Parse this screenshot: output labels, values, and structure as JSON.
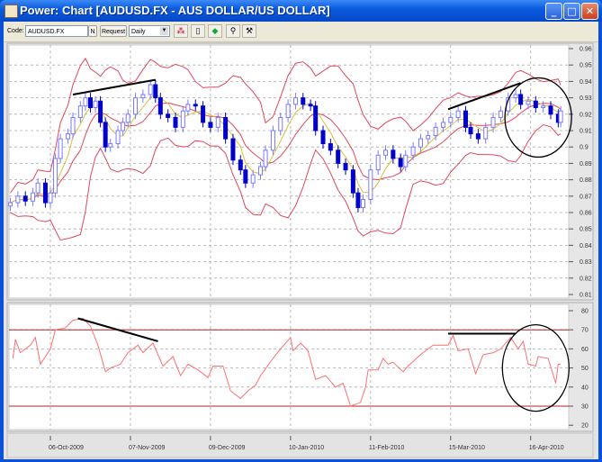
{
  "window": {
    "title": "Power: Chart [AUDUSD.FX - AUS DOLLAR/US DOLLAR]",
    "controls": {
      "minimize": "_",
      "maximize": "□",
      "close": "✕"
    }
  },
  "toolbar": {
    "code_label": "Code:",
    "code_value": "AUDUSD.FX",
    "n_button": "N",
    "request_button": "Request",
    "period_value": "Daily",
    "icons": [
      "chart-style-icon",
      "new-page-icon",
      "color-icon",
      "zoom-icon",
      "tools-icon"
    ]
  },
  "colors": {
    "candle_down": "#0000cc",
    "candle_up": "#7a7aff",
    "bollinger": "#e0485a",
    "moving_average": "#d4c33a",
    "rsi": "#ff7070",
    "rsi_levels": "#b02020",
    "annotation": "#000000"
  },
  "chart_data": [
    {
      "type": "candlestick",
      "panel": "price",
      "yticks": [
        "0.96",
        "0.95",
        "0.94",
        "0.93",
        "0.92",
        "0.91",
        "0.9",
        "0.89",
        "0.88",
        "0.87",
        "0.86",
        "0.85",
        "0.84",
        "0.83",
        "0.82",
        "0.81"
      ],
      "ylim": [
        0.81,
        0.96
      ],
      "grid": true,
      "overlays": [
        "Bollinger Bands",
        "Moving Average"
      ],
      "close": [
        [
          "2009-09-20",
          0.866
        ],
        [
          "2009-09-23",
          0.87
        ],
        [
          "2009-09-26",
          0.867
        ],
        [
          "2009-09-29",
          0.872
        ],
        [
          "2009-10-01",
          0.878
        ],
        [
          "2009-10-04",
          0.866
        ],
        [
          "2009-10-06",
          0.872
        ],
        [
          "2009-10-08",
          0.893
        ],
        [
          "2009-10-10",
          0.905
        ],
        [
          "2009-10-13",
          0.908
        ],
        [
          "2009-10-15",
          0.918
        ],
        [
          "2009-10-18",
          0.925
        ],
        [
          "2009-10-20",
          0.93
        ],
        [
          "2009-10-22",
          0.924
        ],
        [
          "2009-10-24",
          0.928
        ],
        [
          "2009-10-26",
          0.915
        ],
        [
          "2009-10-28",
          0.9
        ],
        [
          "2009-10-30",
          0.902
        ],
        [
          "2009-11-02",
          0.91
        ],
        [
          "2009-11-04",
          0.915
        ],
        [
          "2009-11-06",
          0.92
        ],
        [
          "2009-11-09",
          0.93
        ],
        [
          "2009-11-12",
          0.932
        ],
        [
          "2009-11-15",
          0.938
        ],
        [
          "2009-11-17",
          0.93
        ],
        [
          "2009-11-19",
          0.92
        ],
        [
          "2009-11-22",
          0.918
        ],
        [
          "2009-11-25",
          0.912
        ],
        [
          "2009-11-28",
          0.922
        ],
        [
          "2009-11-30",
          0.926
        ],
        [
          "2009-12-03",
          0.925
        ],
        [
          "2009-12-06",
          0.915
        ],
        [
          "2009-12-09",
          0.912
        ],
        [
          "2009-12-12",
          0.918
        ],
        [
          "2009-12-15",
          0.905
        ],
        [
          "2009-12-18",
          0.892
        ],
        [
          "2009-12-21",
          0.886
        ],
        [
          "2009-12-23",
          0.878
        ],
        [
          "2009-12-26",
          0.883
        ],
        [
          "2009-12-29",
          0.888
        ],
        [
          "2009-12-31",
          0.898
        ],
        [
          "2010-01-03",
          0.91
        ],
        [
          "2010-01-06",
          0.918
        ],
        [
          "2010-01-09",
          0.926
        ],
        [
          "2010-01-12",
          0.93
        ],
        [
          "2010-01-15",
          0.926
        ],
        [
          "2010-01-18",
          0.925
        ],
        [
          "2010-01-20",
          0.91
        ],
        [
          "2010-01-23",
          0.902
        ],
        [
          "2010-01-26",
          0.898
        ],
        [
          "2010-01-29",
          0.89
        ],
        [
          "2010-02-01",
          0.886
        ],
        [
          "2010-02-04",
          0.872
        ],
        [
          "2010-02-06",
          0.863
        ],
        [
          "2010-02-08",
          0.868
        ],
        [
          "2010-02-11",
          0.886
        ],
        [
          "2010-02-14",
          0.895
        ],
        [
          "2010-02-17",
          0.898
        ],
        [
          "2010-02-20",
          0.893
        ],
        [
          "2010-02-23",
          0.888
        ],
        [
          "2010-02-25",
          0.895
        ],
        [
          "2010-02-28",
          0.9
        ],
        [
          "2010-03-03",
          0.905
        ],
        [
          "2010-03-06",
          0.907
        ],
        [
          "2010-03-09",
          0.912
        ],
        [
          "2010-03-12",
          0.915
        ],
        [
          "2010-03-15",
          0.918
        ],
        [
          "2010-03-18",
          0.922
        ],
        [
          "2010-03-21",
          0.912
        ],
        [
          "2010-03-23",
          0.908
        ],
        [
          "2010-03-26",
          0.905
        ],
        [
          "2010-03-29",
          0.912
        ],
        [
          "2010-04-01",
          0.918
        ],
        [
          "2010-04-04",
          0.922
        ],
        [
          "2010-04-07",
          0.93
        ],
        [
          "2010-04-10",
          0.932
        ],
        [
          "2010-04-12",
          0.926
        ],
        [
          "2010-04-15",
          0.928
        ],
        [
          "2010-04-18",
          0.924
        ],
        [
          "2010-04-21",
          0.925
        ],
        [
          "2010-04-24",
          0.92
        ],
        [
          "2010-04-27",
          0.915
        ],
        [
          "2010-04-28",
          0.922
        ]
      ],
      "annotations": {
        "trendlines": [
          [
            [
              "2009-10-15",
              0.932
            ],
            [
              "2009-11-17",
              0.941
            ]
          ],
          [
            [
              "2010-03-14",
              0.923
            ],
            [
              "2010-04-12",
              0.939
            ]
          ]
        ],
        "circle": {
          "center": [
            "2010-04-19",
            0.918
          ],
          "note": "highlight"
        }
      }
    },
    {
      "type": "line",
      "panel": "rsi",
      "yticks": [
        "80",
        "70",
        "60",
        "50",
        "40",
        "30",
        "20"
      ],
      "ylim": [
        20,
        80
      ],
      "levels": [
        70,
        30
      ],
      "grid": true,
      "values": [
        [
          "2009-09-21",
          55
        ],
        [
          "2009-09-22",
          65
        ],
        [
          "2009-09-24",
          58
        ],
        [
          "2009-09-28",
          62
        ],
        [
          "2009-09-30",
          66
        ],
        [
          "2009-10-02",
          52
        ],
        [
          "2009-10-06",
          60
        ],
        [
          "2009-10-08",
          70
        ],
        [
          "2009-10-12",
          71
        ],
        [
          "2009-10-15",
          75
        ],
        [
          "2009-10-19",
          76
        ],
        [
          "2009-10-22",
          72
        ],
        [
          "2009-10-25",
          62
        ],
        [
          "2009-10-28",
          48
        ],
        [
          "2009-10-30",
          50
        ],
        [
          "2009-11-03",
          52
        ],
        [
          "2009-11-06",
          58
        ],
        [
          "2009-11-10",
          62
        ],
        [
          "2009-11-12",
          58
        ],
        [
          "2009-11-16",
          63
        ],
        [
          "2009-11-20",
          51
        ],
        [
          "2009-11-24",
          56
        ],
        [
          "2009-11-27",
          46
        ],
        [
          "2009-11-30",
          52
        ],
        [
          "2009-12-04",
          49
        ],
        [
          "2009-12-08",
          45
        ],
        [
          "2009-12-10",
          51
        ],
        [
          "2009-12-14",
          51
        ],
        [
          "2009-12-17",
          38
        ],
        [
          "2009-12-21",
          34
        ],
        [
          "2009-12-24",
          38
        ],
        [
          "2009-12-27",
          41
        ],
        [
          "2009-12-29",
          46
        ],
        [
          "2010-01-03",
          55
        ],
        [
          "2010-01-06",
          60
        ],
        [
          "2010-01-10",
          66
        ],
        [
          "2010-01-11",
          59
        ],
        [
          "2010-01-14",
          63
        ],
        [
          "2010-01-17",
          59
        ],
        [
          "2010-01-20",
          44
        ],
        [
          "2010-01-24",
          46
        ],
        [
          "2010-01-28",
          40
        ],
        [
          "2010-01-31",
          42
        ],
        [
          "2010-02-03",
          30
        ],
        [
          "2010-02-07",
          32
        ],
        [
          "2010-02-09",
          40
        ],
        [
          "2010-02-10",
          49
        ],
        [
          "2010-02-14",
          49
        ],
        [
          "2010-02-16",
          55
        ],
        [
          "2010-02-18",
          52
        ],
        [
          "2010-02-20",
          53
        ],
        [
          "2010-02-24",
          48
        ],
        [
          "2010-02-26",
          51
        ],
        [
          "2010-03-03",
          57
        ],
        [
          "2010-03-05",
          59
        ],
        [
          "2010-03-08",
          62
        ],
        [
          "2010-03-14",
          62
        ],
        [
          "2010-03-16",
          67
        ],
        [
          "2010-03-18",
          59
        ],
        [
          "2010-03-22",
          60
        ],
        [
          "2010-03-25",
          47
        ],
        [
          "2010-03-28",
          57
        ],
        [
          "2010-04-01",
          58
        ],
        [
          "2010-04-04",
          60
        ],
        [
          "2010-04-08",
          66
        ],
        [
          "2010-04-11",
          60
        ],
        [
          "2010-04-13",
          64
        ],
        [
          "2010-04-15",
          52
        ],
        [
          "2010-04-18",
          51
        ],
        [
          "2010-04-19",
          56
        ],
        [
          "2010-04-23",
          55
        ],
        [
          "2010-04-26",
          42
        ],
        [
          "2010-04-27",
          52
        ],
        [
          "2010-04-28",
          52
        ]
      ],
      "annotations": {
        "trendlines": [
          [
            [
              "2009-10-17",
              76
            ],
            [
              "2009-11-18",
              64
            ]
          ],
          [
            [
              "2010-03-14",
              68
            ],
            [
              "2010-04-10",
              68
            ]
          ]
        ],
        "circle": {
          "center": [
            "2010-04-18",
            50
          ],
          "note": "highlight"
        }
      }
    }
  ],
  "xaxis": {
    "ticks": [
      "06-Oct-2009",
      "07-Nov-2009",
      "09-Dec-2009",
      "10-Jan-2010",
      "11-Feb-2010",
      "15-Mar-2010",
      "16-Apr-2010"
    ],
    "tick_dates": [
      "2009-10-06",
      "2009-11-07",
      "2009-12-09",
      "2010-01-10",
      "2010-02-11",
      "2010-03-15",
      "2010-04-16"
    ]
  }
}
